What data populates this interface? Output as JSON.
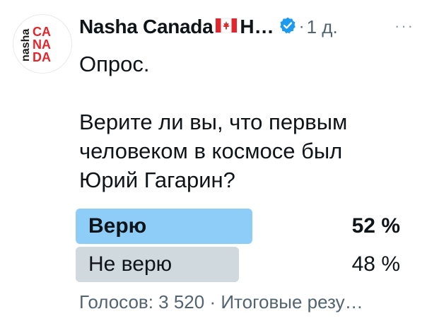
{
  "author": {
    "name": "Nasha Canada",
    "name_truncated": "Н…",
    "handle_time": "1 д.",
    "avatar_text": "nasha CANADA",
    "verified": true
  },
  "more_label": "···",
  "post": {
    "lines": [
      "Опрос.",
      "",
      "Верите ли вы, что первым",
      "человеком в космосе был",
      "Юрий Гагарин?"
    ]
  },
  "poll": {
    "options": [
      {
        "label": "Верю",
        "percent_text": "52 %",
        "percent": 52,
        "winner": true,
        "color": "#8ecdf8"
      },
      {
        "label": "Не верю",
        "percent_text": "48 %",
        "percent": 48,
        "winner": false,
        "color": "#cfd9de"
      }
    ],
    "footer": "Голосов: 3 520 · Итоговые резу…"
  },
  "colors": {
    "accent": "#1d9bf0",
    "brand_red": "#e1262d",
    "secondary_text": "#536471"
  }
}
